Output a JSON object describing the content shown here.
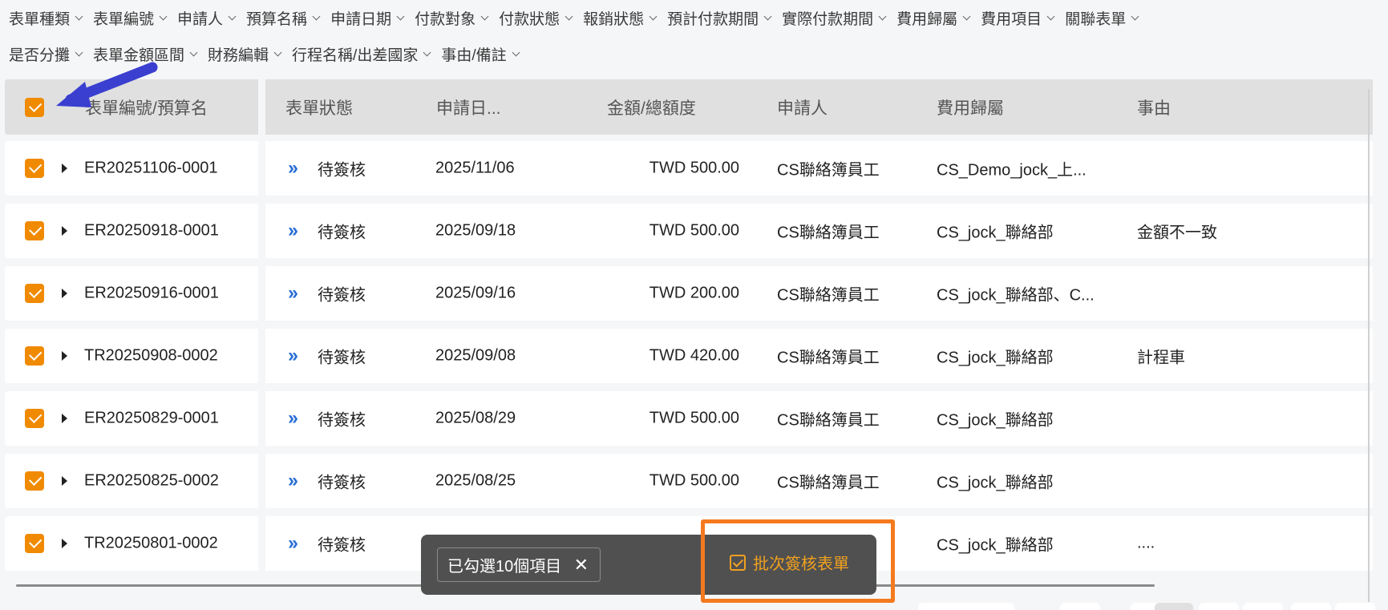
{
  "filters": {
    "row1": [
      "表單種類",
      "表單編號",
      "申請人",
      "預算名稱",
      "申請日期",
      "付款對象",
      "付款狀態",
      "報銷狀態",
      "預計付款期間",
      "實際付款期間",
      "費用歸屬",
      "費用項目",
      "關聯表單"
    ],
    "row2": [
      "是否分攤",
      "表單金額區間",
      "財務編輯",
      "行程名稱/出差國家",
      "事由/備註"
    ]
  },
  "table": {
    "headers": {
      "id": "表單編號/預算名",
      "status": "表單狀態",
      "date": "申請日...",
      "amount": "金額/總額度",
      "applicant": "申請人",
      "dept": "費用歸屬",
      "reason": "事由"
    },
    "rows": [
      {
        "id": "ER20251106-0001",
        "status": "待簽核",
        "date": "2025/11/06",
        "amount": "TWD 500.00",
        "applicant": "CS聯絡簿員工",
        "dept": "CS_Demo_jock_上...",
        "reason": ""
      },
      {
        "id": "ER20250918-0001",
        "status": "待簽核",
        "date": "2025/09/18",
        "amount": "TWD 500.00",
        "applicant": "CS聯絡簿員工",
        "dept": "CS_jock_聯絡部",
        "reason": "金額不一致"
      },
      {
        "id": "ER20250916-0001",
        "status": "待簽核",
        "date": "2025/09/16",
        "amount": "TWD 200.00",
        "applicant": "CS聯絡簿員工",
        "dept": "CS_jock_聯絡部、C...",
        "reason": ""
      },
      {
        "id": "TR20250908-0002",
        "status": "待簽核",
        "date": "2025/09/08",
        "amount": "TWD 420.00",
        "applicant": "CS聯絡簿員工",
        "dept": "CS_jock_聯絡部",
        "reason": "計程車"
      },
      {
        "id": "ER20250829-0001",
        "status": "待簽核",
        "date": "2025/08/29",
        "amount": "TWD 500.00",
        "applicant": "CS聯絡簿員工",
        "dept": "CS_jock_聯絡部",
        "reason": ""
      },
      {
        "id": "ER20250825-0002",
        "status": "待簽核",
        "date": "2025/08/25",
        "amount": "TWD 500.00",
        "applicant": "CS聯絡簿員工",
        "dept": "CS_jock_聯絡部",
        "reason": ""
      },
      {
        "id": "TR20250801-0002",
        "status": "待簽核",
        "date": "",
        "amount": "",
        "applicant": "",
        "dept": "CS_jock_聯絡部",
        "reason": "...."
      }
    ]
  },
  "action_bar": {
    "selected_text": "已勾選10個項目",
    "close_symbol": "✕",
    "batch_label": "批次簽核表單"
  },
  "colors": {
    "accent": "#f08a00",
    "status_icon": "#2a6fd6",
    "highlight": "#f57a1f",
    "annotation_arrow": "#3a3fd0"
  }
}
